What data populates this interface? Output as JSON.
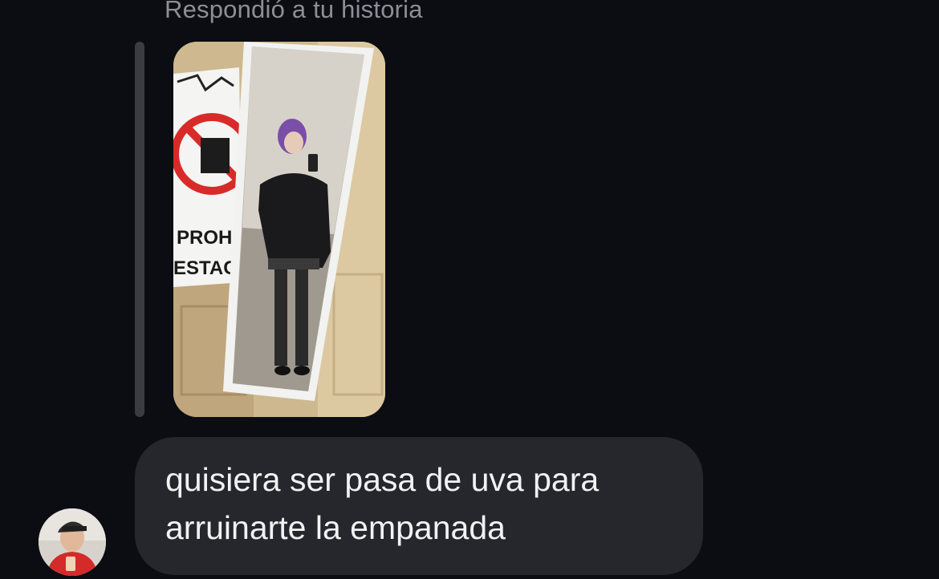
{
  "thread": {
    "reply_caption": "Respondió a tu historia",
    "story": {
      "sign_text_1": "PROHI",
      "sign_text_2": "ESTAC"
    },
    "message": {
      "line1": "quisiera ser pasa de uva para",
      "line2": "arruinarte la empanada"
    }
  },
  "colors": {
    "background": "#0c0d12",
    "bubble": "#26272c",
    "caption": "#8d8f96",
    "message_text": "#f2f2f4",
    "reply_bar": "#3a3c42"
  }
}
